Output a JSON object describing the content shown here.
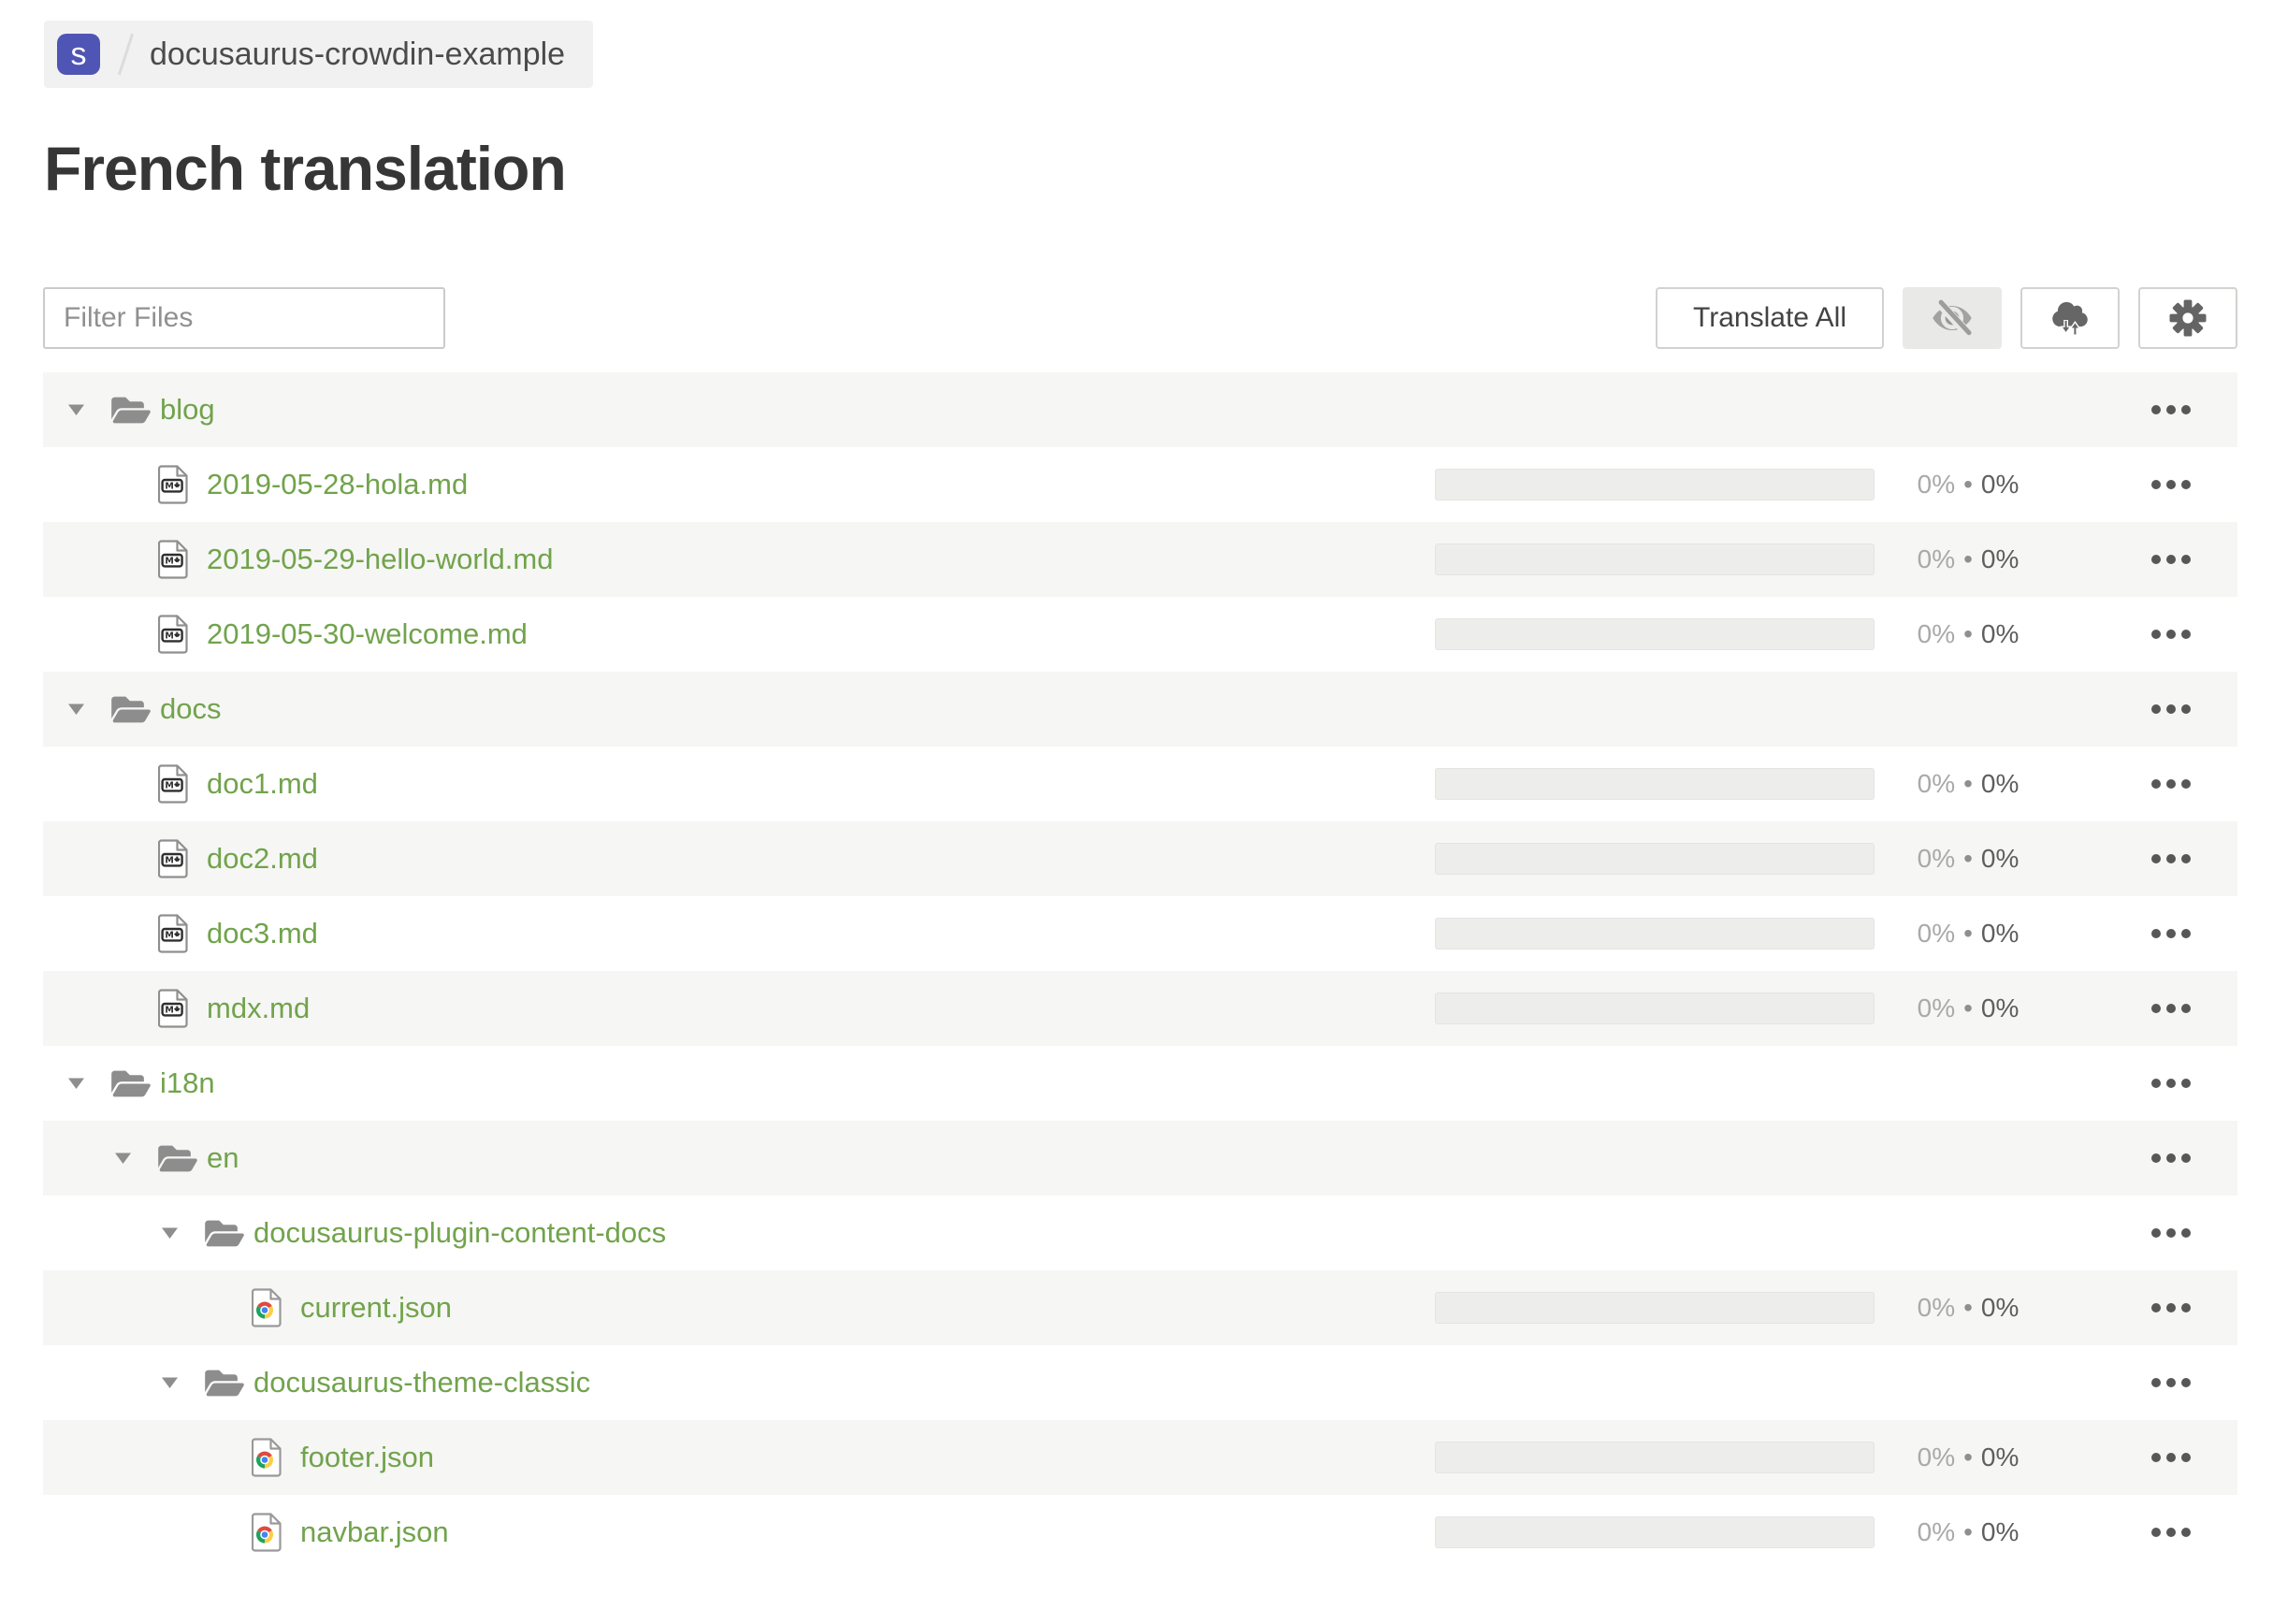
{
  "colors": {
    "accent_green": "#71a34c",
    "badge_indigo": "#4f55b4",
    "stripe_gray": "#f6f6f4",
    "breadcrumb_bg": "#f1f1f1"
  },
  "breadcrumb": {
    "badge_letter": "s",
    "project_name": "docusaurus-crowdin-example"
  },
  "page": {
    "title": "French translation"
  },
  "toolbar": {
    "filter_placeholder": "Filter Files",
    "translate_all_label": "Translate All",
    "hidden_files_toggle_icon": "eye-off-icon",
    "sync_icon": "cloud-sync-icon",
    "settings_icon": "gear-icon"
  },
  "table": {
    "separator": "•",
    "row_menu_icon": "ellipsis-icon",
    "rows": [
      {
        "type": "folder",
        "depth": 0,
        "label": "blog",
        "icon": "folder"
      },
      {
        "type": "file",
        "depth": 1,
        "label": "2019-05-28-hola.md",
        "icon": "md",
        "progress": {
          "translated": "0%",
          "approved": "0%"
        }
      },
      {
        "type": "file",
        "depth": 1,
        "label": "2019-05-29-hello-world.md",
        "icon": "md",
        "progress": {
          "translated": "0%",
          "approved": "0%"
        }
      },
      {
        "type": "file",
        "depth": 1,
        "label": "2019-05-30-welcome.md",
        "icon": "md",
        "progress": {
          "translated": "0%",
          "approved": "0%"
        }
      },
      {
        "type": "folder",
        "depth": 0,
        "label": "docs",
        "icon": "folder"
      },
      {
        "type": "file",
        "depth": 1,
        "label": "doc1.md",
        "icon": "md",
        "progress": {
          "translated": "0%",
          "approved": "0%"
        }
      },
      {
        "type": "file",
        "depth": 1,
        "label": "doc2.md",
        "icon": "md",
        "progress": {
          "translated": "0%",
          "approved": "0%"
        }
      },
      {
        "type": "file",
        "depth": 1,
        "label": "doc3.md",
        "icon": "md",
        "progress": {
          "translated": "0%",
          "approved": "0%"
        }
      },
      {
        "type": "file",
        "depth": 1,
        "label": "mdx.md",
        "icon": "md",
        "progress": {
          "translated": "0%",
          "approved": "0%"
        }
      },
      {
        "type": "folder",
        "depth": 0,
        "label": "i18n",
        "icon": "folder"
      },
      {
        "type": "folder",
        "depth": 1,
        "label": "en",
        "icon": "folder"
      },
      {
        "type": "folder",
        "depth": 2,
        "label": "docusaurus-plugin-content-docs",
        "icon": "folder"
      },
      {
        "type": "file",
        "depth": 3,
        "label": "current.json",
        "icon": "json",
        "progress": {
          "translated": "0%",
          "approved": "0%"
        }
      },
      {
        "type": "folder",
        "depth": 2,
        "label": "docusaurus-theme-classic",
        "icon": "folder"
      },
      {
        "type": "file",
        "depth": 3,
        "label": "footer.json",
        "icon": "json",
        "progress": {
          "translated": "0%",
          "approved": "0%"
        }
      },
      {
        "type": "file",
        "depth": 3,
        "label": "navbar.json",
        "icon": "json",
        "progress": {
          "translated": "0%",
          "approved": "0%"
        }
      }
    ]
  }
}
